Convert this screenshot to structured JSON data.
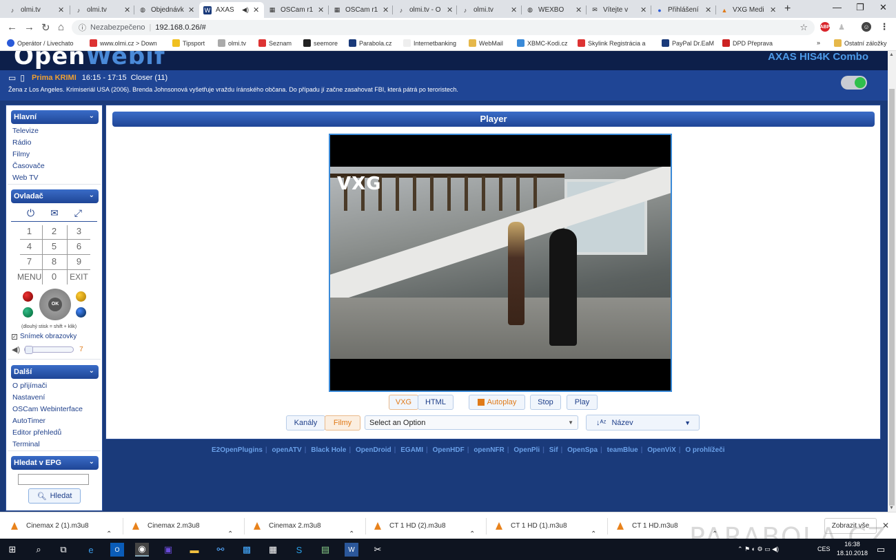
{
  "browser": {
    "tabs": [
      {
        "label": "olmi.tv",
        "icon": "olmi-favicon",
        "active": false
      },
      {
        "label": "olmi.tv",
        "icon": "olmi-favicon",
        "active": false
      },
      {
        "label": "Objednávk",
        "icon": "globe-favicon",
        "active": false
      },
      {
        "label": "AXAS",
        "icon": "openwebif-favicon",
        "active": true
      },
      {
        "label": "OSCam r1",
        "icon": "oscam-favicon",
        "active": false
      },
      {
        "label": "OSCam r1",
        "icon": "oscam-favicon",
        "active": false
      },
      {
        "label": "olmi.tv - O",
        "icon": "olmi-favicon",
        "active": false
      },
      {
        "label": "olmi.tv",
        "icon": "olmi-favicon",
        "active": false
      },
      {
        "label": "WEXBO",
        "icon": "globe-favicon",
        "active": false
      },
      {
        "label": "Vítejte v",
        "icon": "mail-favicon",
        "active": false
      },
      {
        "label": "Přihlášení",
        "icon": "login-favicon",
        "active": false
      },
      {
        "label": "VXG Medi",
        "icon": "vxg-favicon",
        "active": false
      }
    ],
    "security_label": "Nezabezpečeno",
    "url": "192.168.0.26/#",
    "bookmarks": [
      "Operátor / Livechato",
      "www.olmi.cz > Down",
      "Tipsport",
      "olmi.tv",
      "Seznam",
      "seemore",
      "Parabola.cz",
      "Internetbanking",
      "WebMail",
      "XBMC-Kodi.cz",
      "Skylink Registrácia a",
      "PayPal Dr.EaM",
      "DPD Přeprava"
    ],
    "bookmarks_more": "»",
    "other_bookmarks": "Ostatní záložky",
    "ext_abp": "ABP"
  },
  "header": {
    "logo_part1": "Open",
    "logo_part2": "Webif",
    "box_name": "AXAS HIS4K Combo"
  },
  "now_playing": {
    "channel": "Prima KRIMI",
    "time": "16:15 - 17:15",
    "title": "Closer (11)",
    "description": "Žena z Los Angeles. Krimiseriál USA (2006). Brenda Johnsonová vyšetřuje vraždu íránského občana. Do případu jí začne zasahovat FBI, která pátrá po teroristech."
  },
  "sidebar": {
    "main_title": "Hlavní",
    "main_items": [
      "Televize",
      "Rádio",
      "Filmy",
      "Časovače",
      "Web TV"
    ],
    "remote_title": "Ovladač",
    "keys": [
      "1",
      "2",
      "3",
      "4",
      "5",
      "6",
      "7",
      "8",
      "9",
      "MENU",
      "0",
      "EXIT"
    ],
    "ok_label": "OK",
    "remote_hint": "(dlouhý stisk = shift + klik)",
    "screenshot_label": "Snímek obrazovky",
    "volume_value": "7",
    "more_title": "Další",
    "more_items": [
      "O přijímači",
      "Nastavení",
      "OSCam Webinterface",
      "AutoTimer",
      "Editor přehledů",
      "Terminal"
    ],
    "epg_title": "Hledat v EPG",
    "epg_search_placeholder": "",
    "epg_search_button": "Hledat"
  },
  "player": {
    "title": "Player",
    "video_watermark": "VXG",
    "mode_vxg": "VXG",
    "mode_html": "HTML",
    "autoplay": "Autoplay",
    "stop": "Stop",
    "play": "Play",
    "tab_channels": "Kanály",
    "tab_movies": "Filmy",
    "select_placeholder": "Select an Option",
    "sort_label": "Název"
  },
  "footer_links": [
    "E2OpenPlugins",
    "openATV",
    "Black Hole",
    "OpenDroid",
    "EGAMI",
    "OpenHDF",
    "openNFR",
    "OpenPli",
    "Sif",
    "OpenSpa",
    "teamBlue",
    "OpenViX",
    "O prohlížeči"
  ],
  "downloads": {
    "items": [
      "Cinemax 2 (1).m3u8",
      "Cinemax 2.m3u8",
      "Cinemax 2.m3u8",
      "CT 1 HD (2).m3u8",
      "CT 1 HD (1).m3u8",
      "CT 1 HD.m3u8"
    ],
    "show_all": "Zobrazit vše"
  },
  "taskbar": {
    "lang": "CES",
    "time": "16:38",
    "date": "18.10.2018"
  },
  "watermark": "PARABOLA.CZ",
  "colors": {
    "page_bg": "#1a3a7a",
    "header_blue": "#1f4595",
    "accent_orange": "#e07a18",
    "link_blue": "#1e3f8a",
    "toggle_on": "#2fbf4c"
  }
}
